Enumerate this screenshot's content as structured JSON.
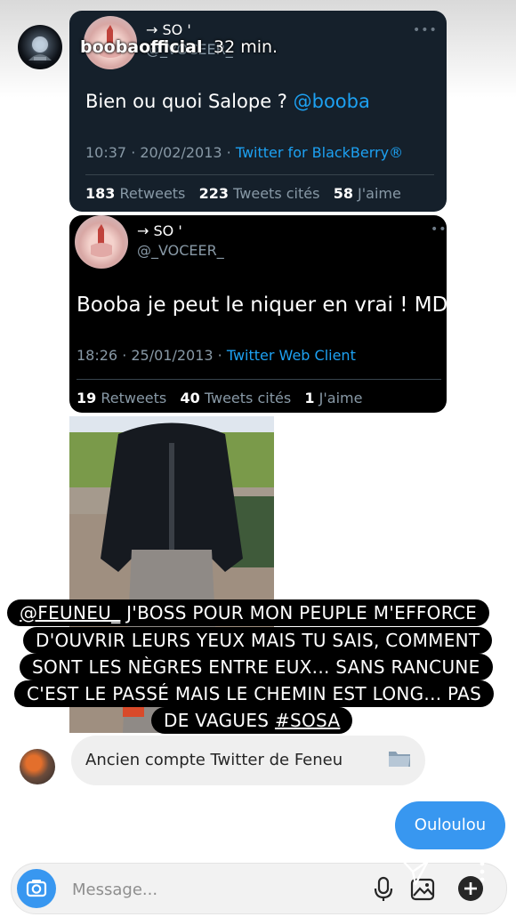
{
  "story_header": {
    "username": "boobaofficial",
    "time_ago": "32 min."
  },
  "tweet1": {
    "display_name": "→ SO '",
    "handle": "@_VOCEER_",
    "more_label": "•••",
    "text_prefix": "Bien ou quoi Salope ? ",
    "mention": "@booba",
    "datetime": "10:37 · 20/02/2013 · ",
    "source": "Twitter for BlackBerry®",
    "retweets_count": "183",
    "retweets_label": " Retweets",
    "quotes_count": "223",
    "quotes_label": " Tweets cités",
    "likes_count": "58",
    "likes_label": " J'aime"
  },
  "tweet2": {
    "display_name": "→ SO '",
    "handle": "@_VOCEER_",
    "more_label": "•••",
    "text": "Booba je peut le niquer en vrai ! MDR",
    "datetime": "18:26 · 25/01/2013 · ",
    "source": "Twitter Web Client",
    "retweets_count": "19",
    "retweets_label": " Retweets",
    "quotes_count": "40",
    "quotes_label": " Tweets cités",
    "likes_count": "1",
    "likes_label": " J'aime"
  },
  "caption": {
    "mention": "@FEUNEU_",
    "line1_rest": "  J'BOSS POUR MON PEUPLE M'EFFORCE",
    "line2": "D'OUVRIR LEURS YEUX MAIS TU SAIS, COMMENT",
    "line3": "SONT LES NÈGRES ENTRE EUX... SANS RANCUNE",
    "line4": "C'EST LE PASSÉ MAIS LE CHEMIN EST LONG... PAS",
    "line5_prefix": "DE VAGUES ",
    "hashtag": "#SOSA"
  },
  "messages": {
    "received": "Ancien compte Twitter de Feneu",
    "sent": "Ouloulou"
  },
  "composer": {
    "placeholder": "Message..."
  },
  "colors": {
    "twitter_blue": "#1da1f2",
    "dim_background": "#15202b",
    "instagram_blue": "#3897f0"
  }
}
